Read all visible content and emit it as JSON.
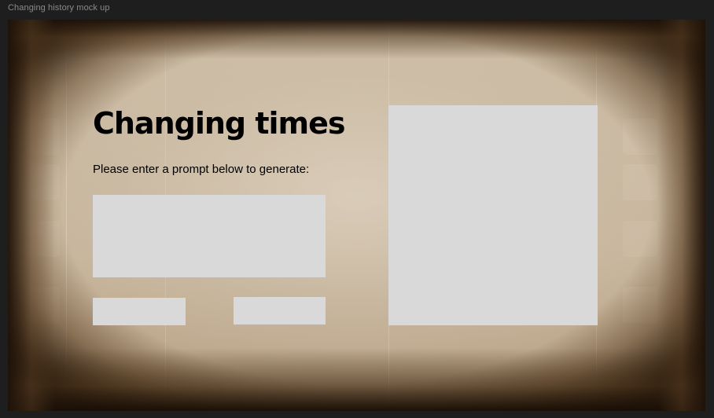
{
  "window": {
    "frame_title": "Changing history mock up"
  },
  "content": {
    "headline": "Changing times",
    "prompt_instruction": "Please enter a prompt below to generate:"
  },
  "colors": {
    "placeholder_fill": "#d9d9d9",
    "background_sepia": "#c9b9a2",
    "text": "#000000"
  }
}
